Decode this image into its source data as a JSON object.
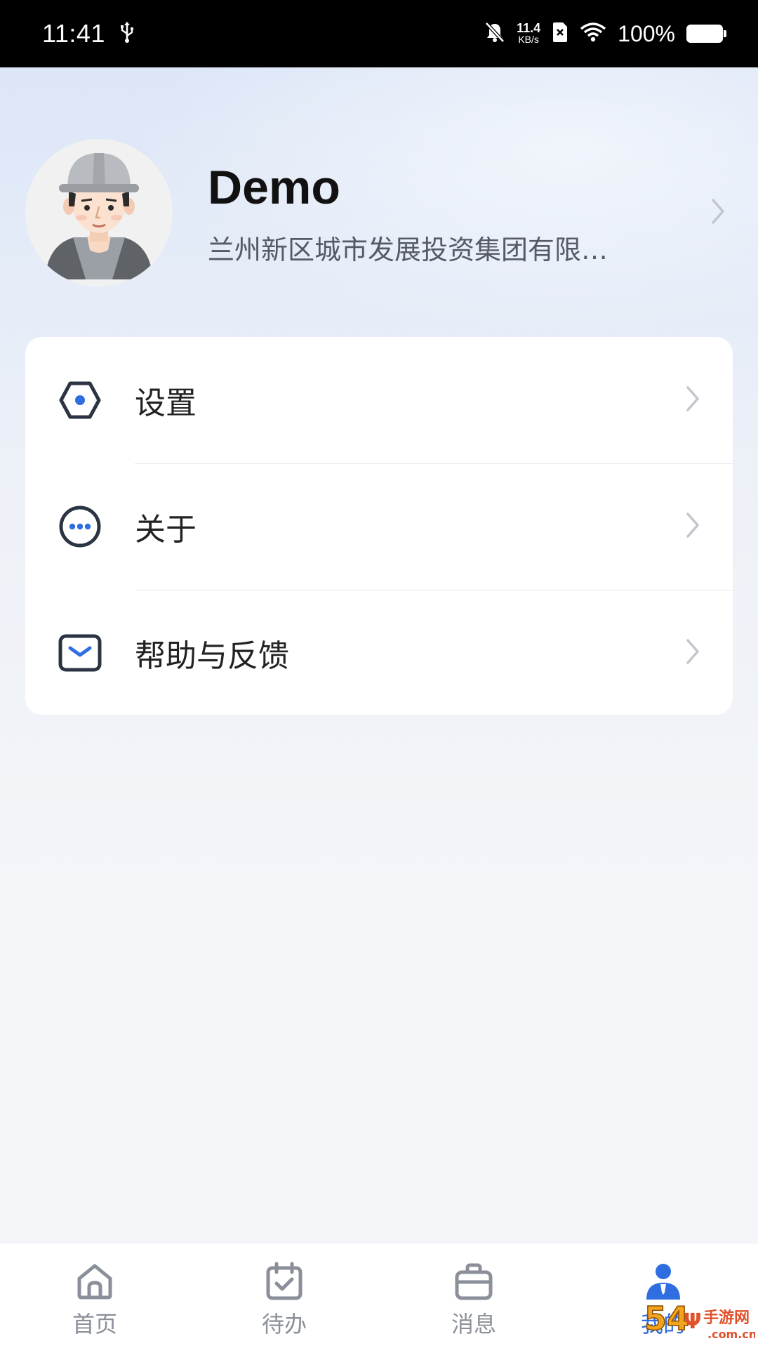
{
  "status_bar": {
    "time": "11:41",
    "net_speed_value": "11.4",
    "net_speed_unit": "KB/s",
    "battery": "100%",
    "icons": [
      "usb-icon",
      "bell-off-icon",
      "sim-off-icon",
      "wifi-icon",
      "battery-icon"
    ]
  },
  "profile": {
    "name": "Demo",
    "organization": "兰州新区城市发展投资集团有限…"
  },
  "menu": {
    "items": [
      {
        "label": "设置",
        "icon": "settings-hexagon-icon"
      },
      {
        "label": "关于",
        "icon": "more-dots-icon"
      },
      {
        "label": "帮助与反馈",
        "icon": "mail-icon"
      }
    ]
  },
  "tab_bar": {
    "active_index": 3,
    "tabs": [
      {
        "label": "首页",
        "icon": "home-icon"
      },
      {
        "label": "待办",
        "icon": "calendar-check-icon"
      },
      {
        "label": "消息",
        "icon": "briefcase-icon"
      },
      {
        "label": "我的",
        "icon": "profile-person-icon"
      }
    ]
  },
  "watermark": {
    "text": "54Ψ手游网",
    "subtext": ".com.cn"
  },
  "colors": {
    "accent": "#2f6ee0",
    "icon_dark": "#2b3442",
    "text_primary": "#222222",
    "text_secondary": "#555a66",
    "tab_inactive": "#8a8f99"
  }
}
